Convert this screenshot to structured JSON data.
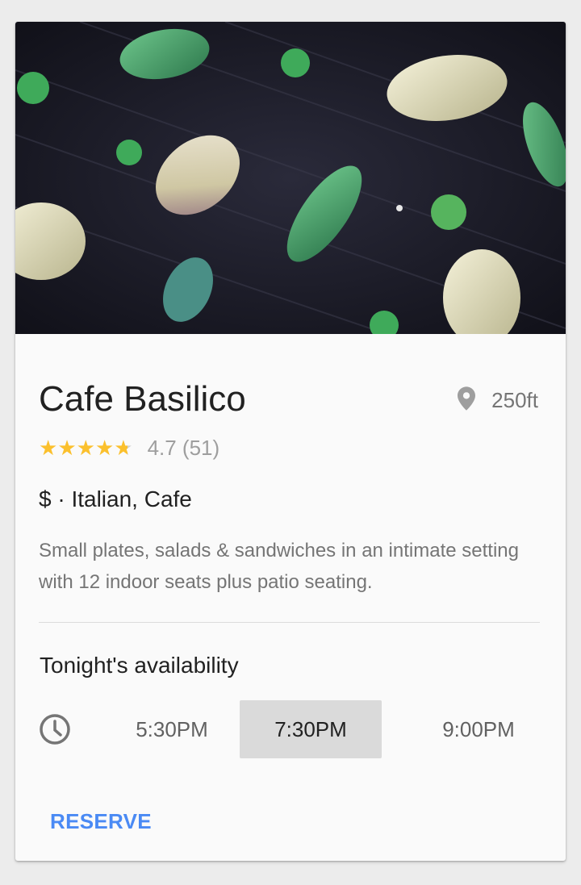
{
  "restaurant": {
    "name": "Cafe Basilico",
    "distance": "250ft",
    "rating_text": "4.7 (51)",
    "rating_value": 4.7,
    "stars_max": 5,
    "price_category": "$ · Italian, Cafe",
    "description": "Small plates, salads & sandwiches in an intimate setting with 12 indoor seats plus patio seating."
  },
  "availability": {
    "title": "Tonight's availability",
    "times": [
      "5:30PM",
      "7:30PM",
      "9:00PM"
    ],
    "selected_index": 1
  },
  "actions": {
    "reserve_label": "RESERVE"
  },
  "colors": {
    "star": "#fbc02d",
    "star_empty": "#d0d0d0",
    "accent": "#4a8af4"
  },
  "icons": {
    "location": "location-pin-icon",
    "clock": "clock-icon"
  }
}
